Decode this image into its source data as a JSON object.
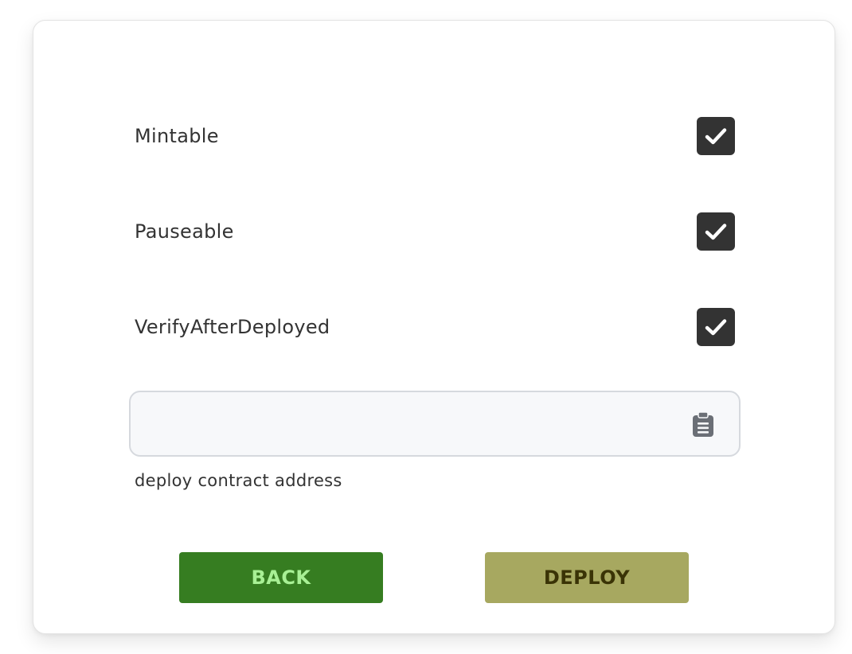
{
  "options": [
    {
      "label": "Mintable",
      "checked": true
    },
    {
      "label": "Pauseable",
      "checked": true
    },
    {
      "label": "VerifyAfterDeployed",
      "checked": true
    }
  ],
  "address_field": {
    "value": "",
    "placeholder": "",
    "icon": "clipboard-icon",
    "helper_text": "deploy contract address"
  },
  "buttons": {
    "back_label": "BACK",
    "deploy_label": "DEPLOY"
  },
  "colors": {
    "checkbox_bg": "#333333",
    "back_bg": "#367d21",
    "back_text": "#a8f095",
    "deploy_bg": "#a7a860",
    "deploy_text": "#3a3306"
  }
}
